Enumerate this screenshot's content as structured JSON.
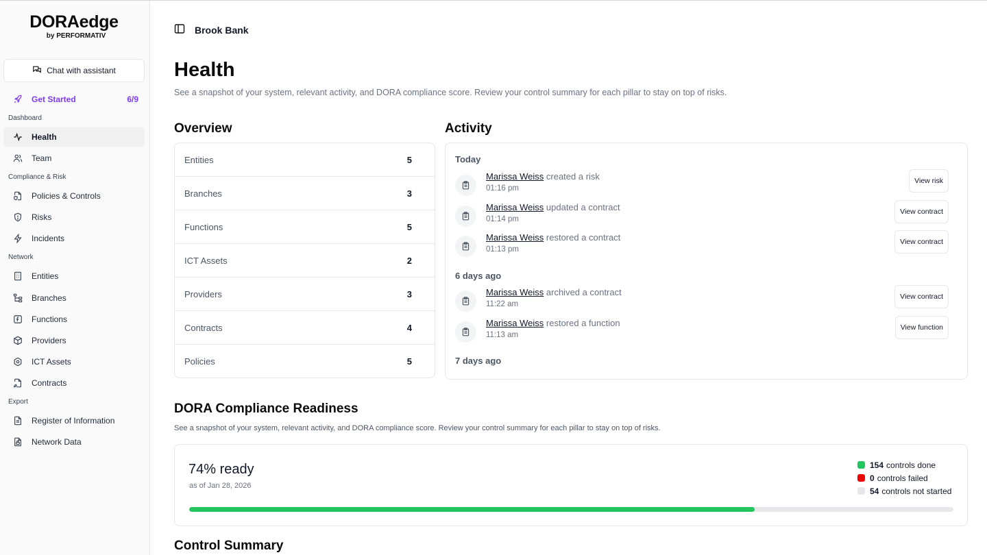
{
  "brand": {
    "name": "DORAedge",
    "by": "by PERFORMATIV"
  },
  "sidebar": {
    "chat_label": "Chat with assistant",
    "get_started": {
      "label": "Get Started",
      "count": "6/9"
    },
    "sections": {
      "dashboard": "Dashboard",
      "compliance": "Compliance & Risk",
      "network": "Network",
      "export": "Export"
    },
    "items": {
      "health": "Health",
      "team": "Team",
      "policies": "Policies & Controls",
      "risks": "Risks",
      "incidents": "Incidents",
      "entities": "Entities",
      "branches": "Branches",
      "functions": "Functions",
      "providers": "Providers",
      "ict_assets": "ICT Assets",
      "contracts": "Contracts",
      "register": "Register of Information",
      "network_data": "Network Data"
    }
  },
  "header": {
    "org": "Brook Bank"
  },
  "page": {
    "title": "Health",
    "subtitle": "See a snapshot of your system, relevant activity, and DORA compliance score. Review your control summary for each pillar to stay on top of risks."
  },
  "overview": {
    "title": "Overview",
    "rows": [
      {
        "label": "Entities",
        "value": "5"
      },
      {
        "label": "Branches",
        "value": "3"
      },
      {
        "label": "Functions",
        "value": "5"
      },
      {
        "label": "ICT Assets",
        "value": "2"
      },
      {
        "label": "Providers",
        "value": "3"
      },
      {
        "label": "Contracts",
        "value": "4"
      },
      {
        "label": "Policies",
        "value": "5"
      }
    ]
  },
  "activity": {
    "title": "Activity",
    "groups": [
      "Today",
      "6 days ago",
      "7 days ago"
    ],
    "items": [
      {
        "user": "Marissa Weiss",
        "action": " created a risk",
        "time": "01:16 pm",
        "button": "View risk"
      },
      {
        "user": "Marissa Weiss",
        "action": " updated a contract",
        "time": "01:14 pm",
        "button": "View contract"
      },
      {
        "user": "Marissa Weiss",
        "action": " restored a contract",
        "time": "01:13 pm",
        "button": "View contract"
      },
      {
        "user": "Marissa Weiss",
        "action": " archived a contract",
        "time": "11:22 am",
        "button": "View contract"
      },
      {
        "user": "Marissa Weiss",
        "action": " restored a function",
        "time": "11:13 am",
        "button": "View function"
      }
    ]
  },
  "dora": {
    "title": "DORA Compliance Readiness",
    "subtitle": "See a snapshot of your system, relevant activity, and DORA compliance score. Review your control summary for each pillar to stay on top of risks.",
    "ready": "74% ready",
    "as_of": "as of Jan 28, 2026",
    "progress": 0.74,
    "legend": [
      {
        "count": "154",
        "label": "controls done",
        "color": "#22c55e"
      },
      {
        "count": "0",
        "label": "controls failed",
        "color": "#ef0000"
      },
      {
        "count": "54",
        "label": "controls not started",
        "color": "#e5e7eb"
      }
    ]
  },
  "control_summary": {
    "title": "Control Summary"
  },
  "colors": {
    "accent": "#7c3aed",
    "done": "#22c55e",
    "failed": "#ef0000",
    "not_started": "#e5e7eb"
  }
}
